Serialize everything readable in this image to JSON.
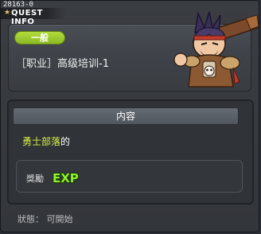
{
  "window": {
    "id_label": "28163-0",
    "title": "QUEST INFO"
  },
  "quest": {
    "level_badge": "一般",
    "name": "［职业］高级培训-1"
  },
  "content": {
    "header": "内容",
    "description_highlight": "勇士部落",
    "description_suffix": "的"
  },
  "reward": {
    "label": "獎勵",
    "exp_icon_text": "EXP"
  },
  "status": {
    "text": "狀態： 可開始"
  },
  "colors": {
    "accent_green": "#9ccb2c",
    "highlight_yellow": "#d7f04a",
    "exp_green": "#8ef02e"
  },
  "icons": [
    "star-icon",
    "exp-icon",
    "character-portrait"
  ]
}
